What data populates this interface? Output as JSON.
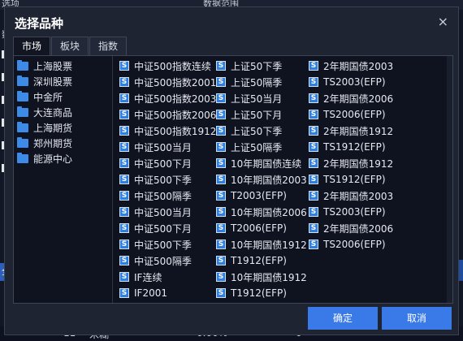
{
  "background": {
    "top_left": "选项",
    "top_right": "数据范围",
    "left_label": "数",
    "left_all": "全",
    "bottom_row": [
      "11",
      "米糊",
      "0.00%",
      "0"
    ]
  },
  "dialog": {
    "title": "选择品种",
    "close_glyph": "×",
    "tabs": [
      "市场",
      "板块",
      "指数"
    ],
    "active_tab": "市场",
    "tree": [
      "上海股票",
      "深圳股票",
      "中金所",
      "大连商品",
      "上海期货",
      "郑州期货",
      "能源中心"
    ],
    "columns": [
      [
        "中证500指数连续",
        "中证500指数2001",
        "中证500指数2003",
        "中证500指数2006",
        "中证500指数1912",
        "中证500当月",
        "中证500下月",
        "中证500下季",
        "中证500隔季",
        "中证500当月",
        "中证500下月",
        "中证500下季",
        "中证500隔季",
        "IF连续",
        "IF2001"
      ],
      [
        "上证50下季",
        "上证50隔季",
        "上证50当月",
        "上证50下月",
        "上证50下季",
        "上证50隔季",
        "10年期国债连续",
        "10年期国债2003",
        "T2003(EFP)",
        "10年期国债2006",
        "T2006(EFP)",
        "10年期国债1912",
        "T1912(EFP)",
        "10年期国债1912",
        "T1912(EFP)"
      ],
      [
        "2年期国债2003",
        "TS2003(EFP)",
        "2年期国债2006",
        "TS2006(EFP)",
        "2年期国债1912",
        "TS1912(EFP)",
        "2年期国债1912",
        "TS1912(EFP)",
        "2年期国债2003",
        "TS2003(EFP)",
        "2年期国债2006",
        "TS2006(EFP)"
      ]
    ],
    "item_icon": "S",
    "buttons": {
      "ok": "确定",
      "cancel": "取消"
    }
  },
  "colors": {
    "accent": "#3a7ae8",
    "folder": "#3d8be6",
    "icon": "#2f7fde"
  }
}
